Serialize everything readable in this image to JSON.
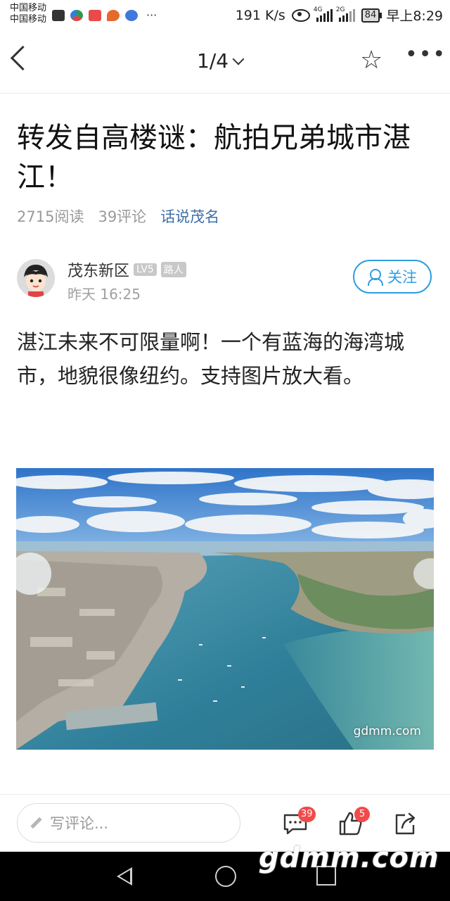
{
  "status_bar": {
    "carrier1": "中国移动",
    "carrier2": "中国移动",
    "speed": "191 K/s",
    "net1": "4G",
    "net2": "2G",
    "battery": "84",
    "time": "早上8:29"
  },
  "nav": {
    "pager": "1/4"
  },
  "article": {
    "title": "转发自高楼谜：航拍兄弟城市湛江！",
    "reads": "2715阅读",
    "comments": "39评论",
    "topic": "话说茂名",
    "body": "湛江未来不可限量啊！一个有蓝海的海湾城市，地貌很像纽约。支持图片放大看。",
    "image_watermark": "gdmm.com"
  },
  "author": {
    "name": "茂东新区",
    "level": "LV5",
    "rank": "路人",
    "time": "昨天 16:25",
    "follow_label": "关注"
  },
  "bottom_bar": {
    "comment_placeholder": "写评论...",
    "comment_count": "39",
    "like_count": "5"
  },
  "overlay_watermark": "gdmm.com",
  "colors": {
    "accent": "#2f9de0",
    "topic": "#3e6fa8",
    "badge_red": "#f24a4a"
  }
}
